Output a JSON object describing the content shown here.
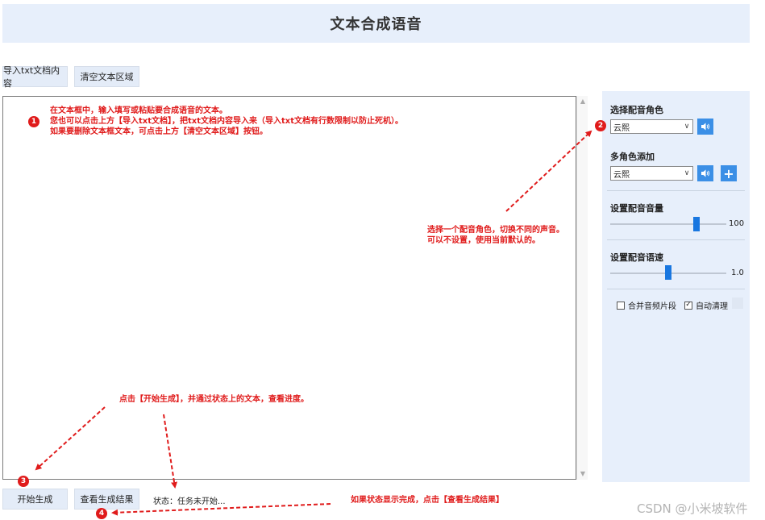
{
  "window": {
    "title": "文本合成语音"
  },
  "toolbar": {
    "import_label": "导入txt文档内容",
    "clear_label": "清空文本区域"
  },
  "textarea": {
    "value": ""
  },
  "right_panel": {
    "voice_label": "选择配音角色",
    "voice_value": "云熙",
    "multi_label": "多角色添加",
    "multi_value": "云熙",
    "volume_label": "设置配音音量",
    "volume_value": "100",
    "volume_level": 0.74,
    "speed_label": "设置配音语速",
    "speed_value": "1.0",
    "speed_level": 0.5,
    "merge_label": "合并音频片段",
    "merge_checked": false,
    "auto_clean_label": "自动清理",
    "auto_clean_checked": true
  },
  "bottom": {
    "start_label": "开始生成",
    "view_label": "查看生成结果",
    "status_text": "状态：任务未开始..."
  },
  "annotations": {
    "note1_line1": "在文本框中，输入填写或粘贴要合成语音的文本。",
    "note1_line2": "您也可以点击上方【导入txt文档】，把txt文档内容导入来（导入txt文档有行数限制以防止死机）。",
    "note1_line3": "如果要删除文本框文本，可点击上方【清空文本区域】按钮。",
    "note2_line1": "选择一个配音角色，切换不同的声音。",
    "note2_line2": "可以不设置，使用当前默认的。",
    "note3": "点击【开始生成】，并通过状态上的文本，查看进度。",
    "note4": "如果状态显示完成，点击【查看生成结果】",
    "badge1": "1",
    "badge2": "2",
    "badge3": "3",
    "badge4": "4"
  },
  "watermark": "CSDN @小米坡软件",
  "colors": {
    "accent": "#1977e0",
    "annotation": "#e01b1b",
    "panel_bg": "#e7effb"
  }
}
